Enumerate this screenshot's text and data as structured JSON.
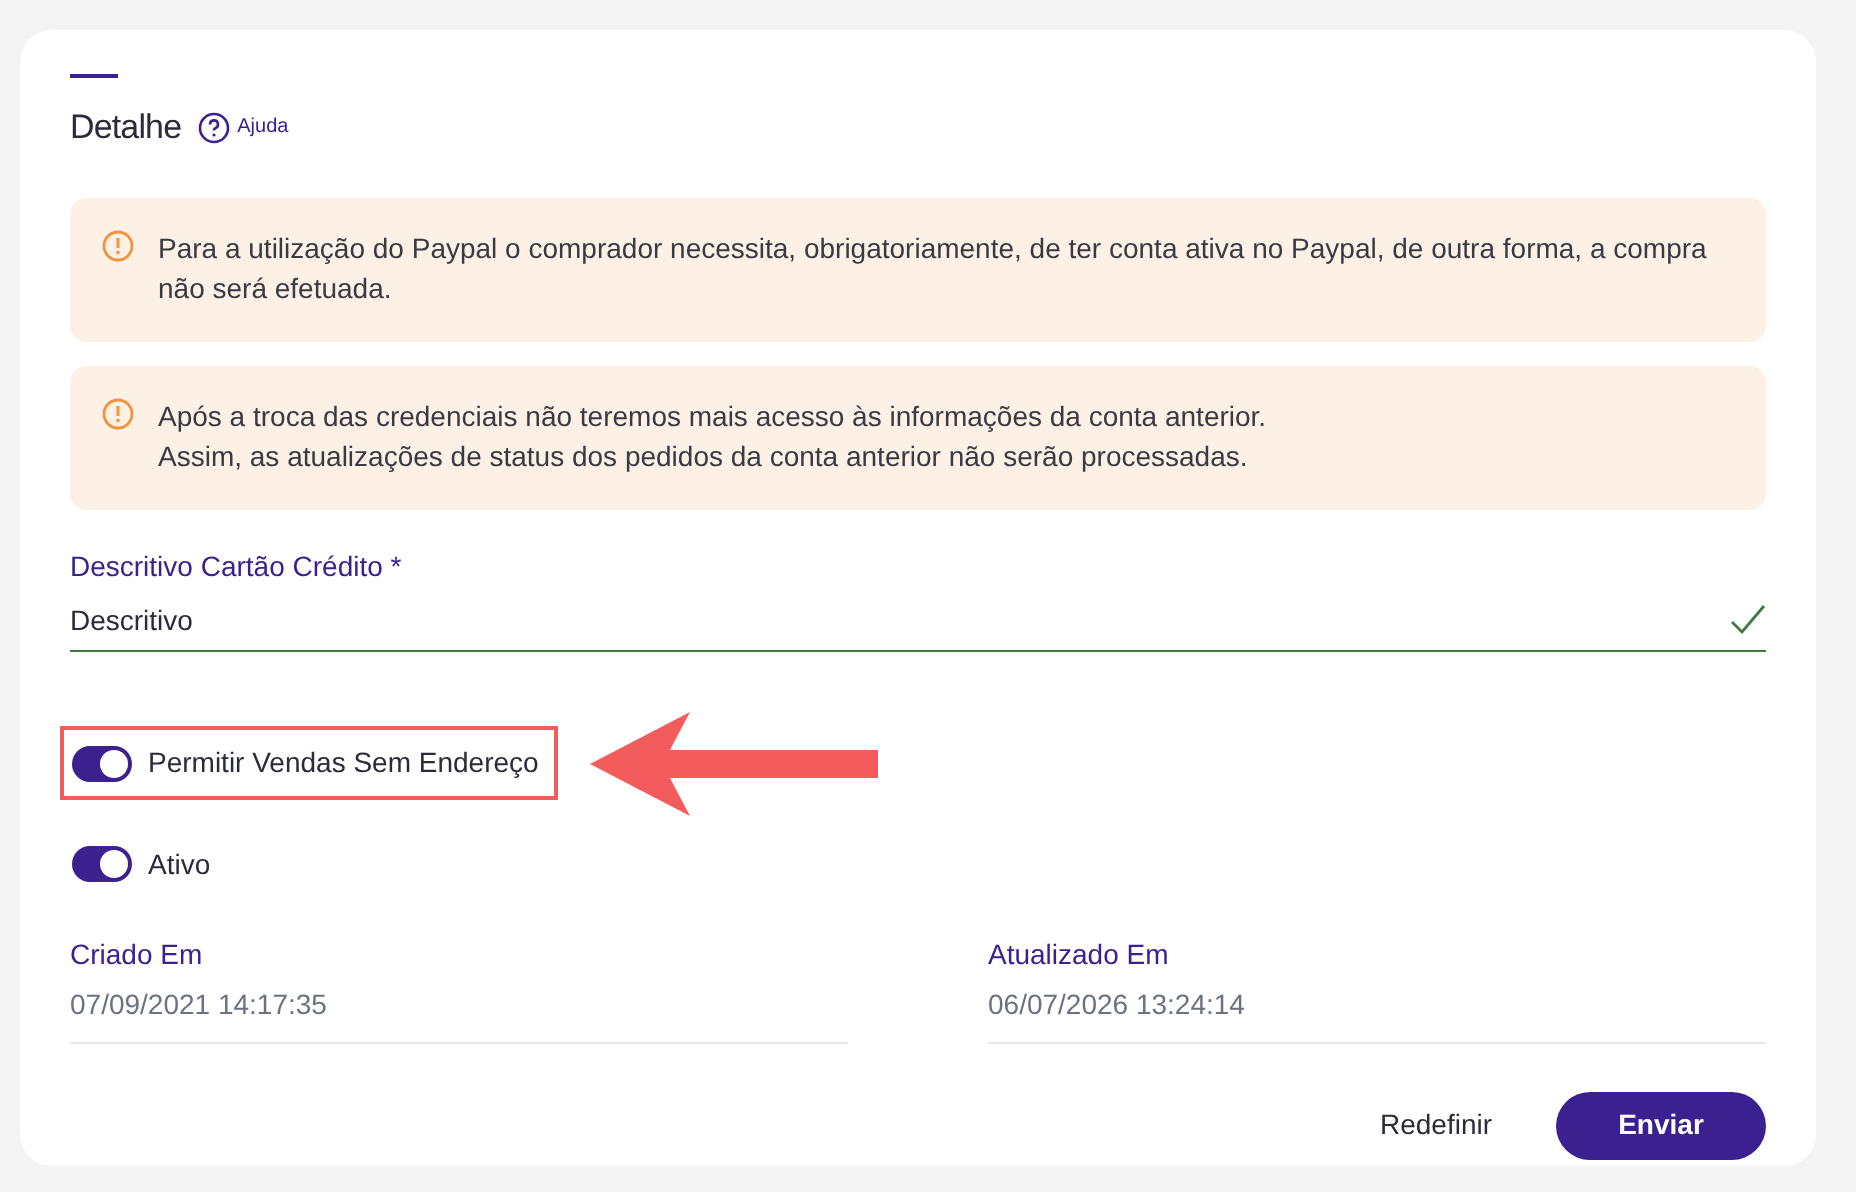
{
  "header": {
    "title": "Detalhe",
    "help": "Ajuda"
  },
  "alerts": [
    "Para a utilização do Paypal o comprador necessita, obrigatoriamente, de ter conta ativa no Paypal, de outra forma, a compra não será efetuada.",
    "Após a troca das credenciais não teremos mais acesso às informações da conta anterior.\nAssim, as atualizações de status dos pedidos da conta anterior não serão processadas."
  ],
  "field": {
    "label": "Descritivo Cartão Crédito",
    "required": "*",
    "value": "Descritivo",
    "valid": true
  },
  "toggles": [
    {
      "label": "Permitir Vendas Sem Endereço",
      "on": true,
      "highlighted": true
    },
    {
      "label": "Ativo",
      "on": true,
      "highlighted": false
    }
  ],
  "dates": [
    {
      "label": "Criado Em",
      "value": "07/09/2021 14:17:35"
    },
    {
      "label": "Atualizado Em",
      "value": "06/07/2026 13:24:14"
    }
  ],
  "buttons": {
    "reset": "Redefinir",
    "submit": "Enviar"
  }
}
